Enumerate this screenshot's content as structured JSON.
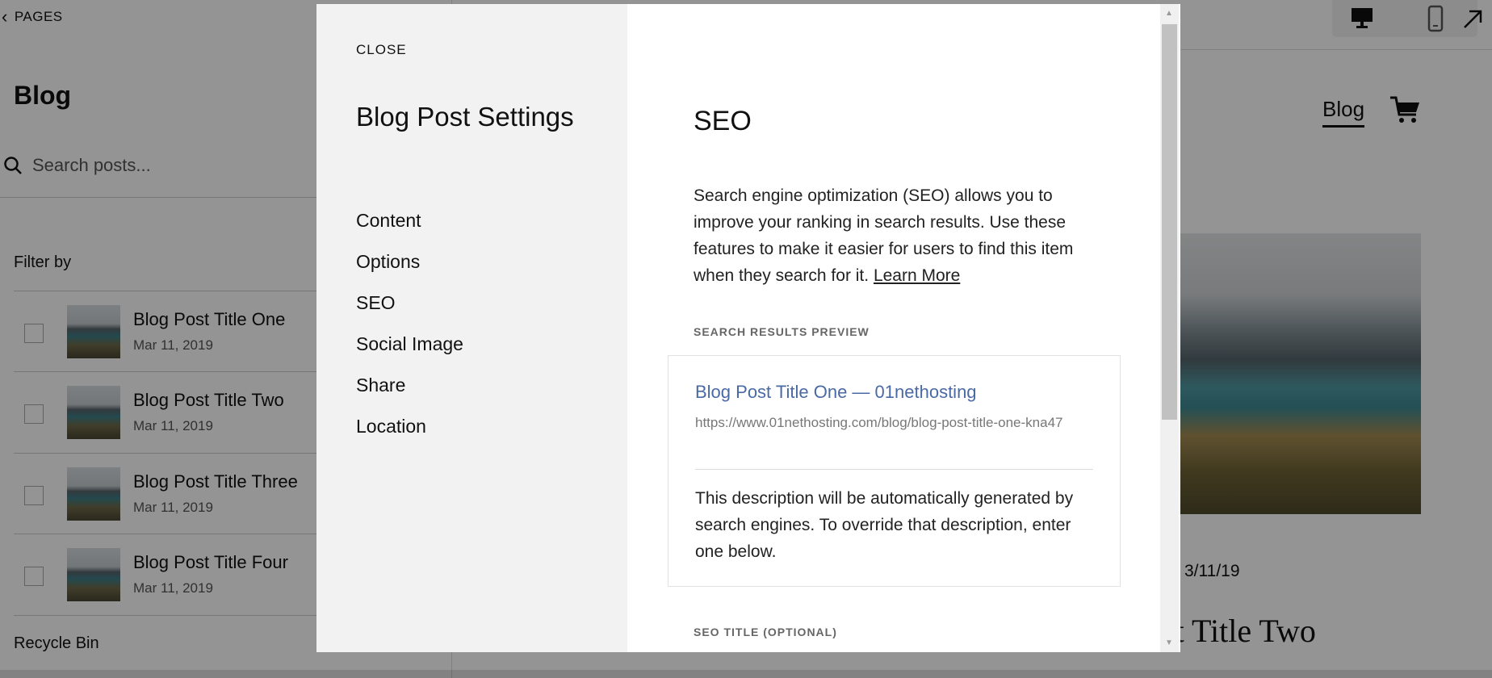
{
  "sidebar": {
    "back_label": "PAGES",
    "title": "Blog",
    "search_placeholder": "Search posts...",
    "filter_label": "Filter by",
    "posts": [
      {
        "title": "Blog Post Title One",
        "date": "Mar 11, 2019"
      },
      {
        "title": "Blog Post Title Two",
        "date": "Mar 11, 2019"
      },
      {
        "title": "Blog Post Title Three",
        "date": "Mar 11, 2019"
      },
      {
        "title": "Blog Post Title Four",
        "date": "Mar 11, 2019"
      }
    ],
    "recycle_bin": "Recycle Bin"
  },
  "preview": {
    "nav_blog": "Blog",
    "date": "3/11/19",
    "post_title_partial": "st Title Two"
  },
  "modal": {
    "close_label": "CLOSE",
    "title": "Blog Post Settings",
    "nav": [
      "Content",
      "Options",
      "SEO",
      "Social Image",
      "Share",
      "Location"
    ],
    "seo": {
      "heading": "SEO",
      "description": "Search engine optimization (SEO) allows you to improve your ranking in search results. Use these features to make it easier for users to find this item when they search for it.",
      "learn_more": "Learn More",
      "preview_label": "SEARCH RESULTS PREVIEW",
      "preview_title": "Blog Post Title One — 01nethosting",
      "preview_url": "https://www.01nethosting.com/blog/blog-post-title-one-kna47",
      "preview_desc": "This description will be automatically generated by search engines. To override that description, enter one below.",
      "seo_title_label": "SEO TITLE (OPTIONAL)"
    }
  },
  "colors": {
    "link": "#4a6aa5",
    "overlay": "rgba(0,0,0,0.42)"
  }
}
